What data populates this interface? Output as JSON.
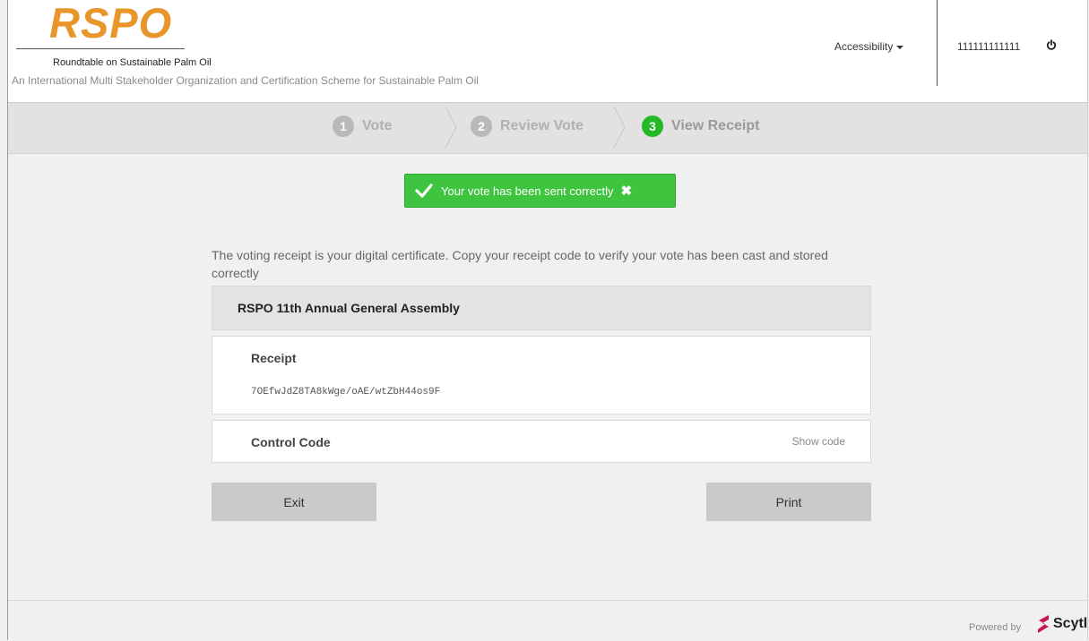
{
  "header": {
    "logo_text": "RSPO",
    "logo_subtitle": "Roundtable on Sustainable Palm Oil",
    "tagline": "An International Multi Stakeholder Organization and Certification Scheme for Sustainable Palm Oil",
    "accessibility_label": "Accessibility",
    "user_id": "111111111111",
    "power_icon": "power-icon"
  },
  "steps": [
    {
      "number": "1",
      "label": "Vote",
      "active": false
    },
    {
      "number": "2",
      "label": "Review Vote",
      "active": false
    },
    {
      "number": "3",
      "label": "View Receipt",
      "active": true
    }
  ],
  "alert": {
    "message": "Your vote has been sent correctly",
    "close": "✖",
    "color": "#3ec43e"
  },
  "content": {
    "intro": "The voting receipt is your digital certificate. Copy your receipt code to verify your vote has been cast and stored correctly",
    "election_title": "RSPO 11th Annual General Assembly",
    "receipt_label": "Receipt",
    "receipt_code": "7OEfwJdZ8TA8kWge/oAE/wtZbH44os9F",
    "control_code_label": "Control Code",
    "show_code_label": "Show code"
  },
  "buttons": {
    "exit": "Exit",
    "print": "Print"
  },
  "footer": {
    "powered_by": "Powered by",
    "brand": "Scytl"
  },
  "colors": {
    "brand_orange": "#e8952a",
    "active_step_green": "#26b926"
  }
}
